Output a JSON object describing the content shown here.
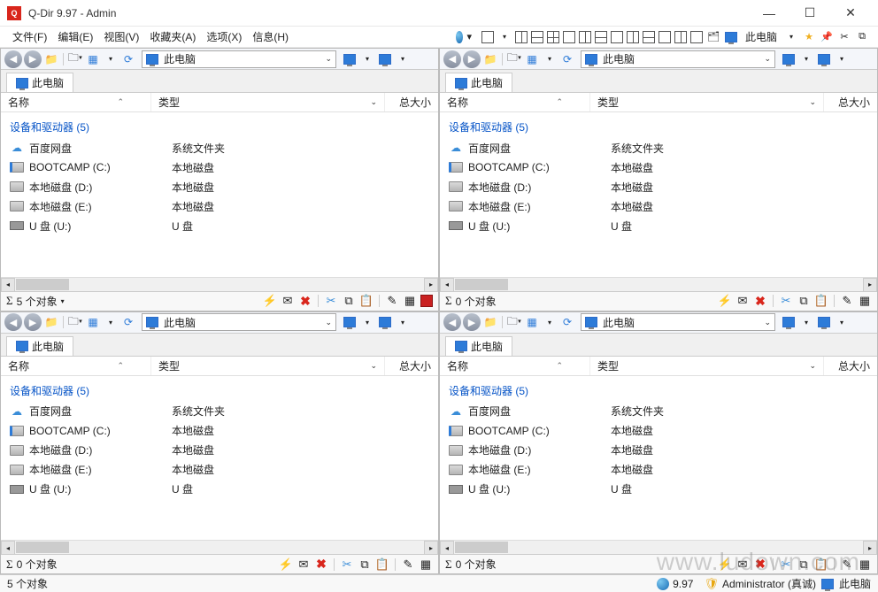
{
  "titlebar": {
    "title": "Q-Dir 9.97 - Admin"
  },
  "menu": {
    "file": "文件(F)",
    "edit": "编辑(E)",
    "view": "视图(V)",
    "favorites": "收藏夹(A)",
    "options": "选项(X)",
    "info": "信息(H)",
    "computer_label": "此电脑"
  },
  "pane": {
    "path_label": "此电脑",
    "tab_label": "此电脑",
    "col_name": "名称",
    "col_type": "类型",
    "col_size": "总大小",
    "group_header": "设备和驱动器 (5)",
    "rows": [
      {
        "icon": "cloud",
        "name": "百度网盘",
        "type": "系统文件夹"
      },
      {
        "icon": "bootdisk",
        "name": "BOOTCAMP (C:)",
        "type": "本地磁盘"
      },
      {
        "icon": "disk",
        "name": "本地磁盘 (D:)",
        "type": "本地磁盘"
      },
      {
        "icon": "disk",
        "name": "本地磁盘 (E:)",
        "type": "本地磁盘"
      },
      {
        "icon": "usb",
        "name": "U 盘 (U:)",
        "type": "U 盘"
      }
    ],
    "status_5": "5 个对象",
    "status_0": "0 个对象"
  },
  "statusbar": {
    "left": "5 个对象",
    "version": "9.97",
    "user": "Administrator (真诚)",
    "location": "此电脑"
  },
  "watermark": "www.ludown.com"
}
